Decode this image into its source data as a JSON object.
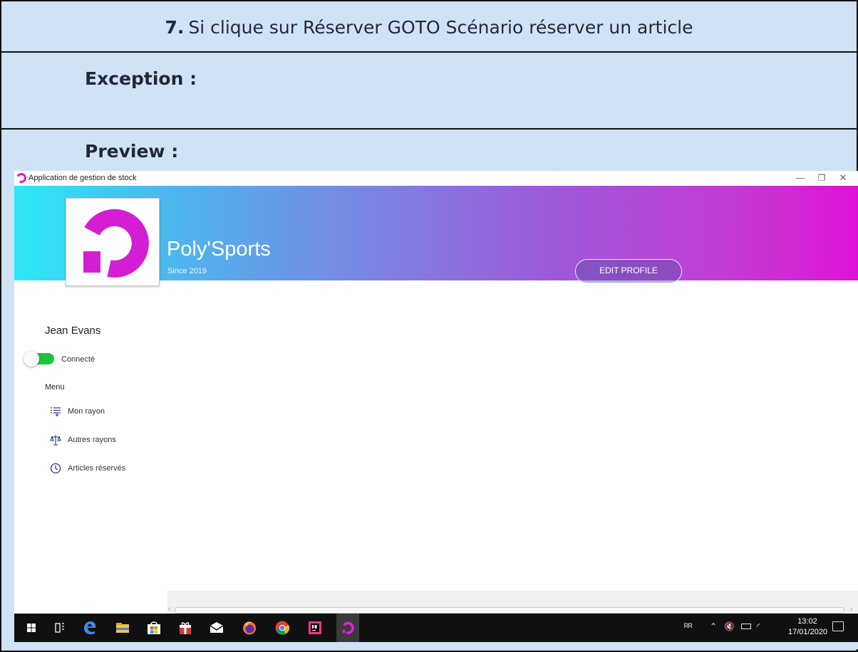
{
  "document": {
    "step_number": "7.",
    "step_text": "Si clique sur Réserver GOTO Scénario réserver un article",
    "exception_label": "Exception :",
    "preview_label": "Preview :"
  },
  "window": {
    "title": "Application de gestion de stock",
    "controls": {
      "minimize": "—",
      "maximize": "❐",
      "close": "✕"
    }
  },
  "header": {
    "brand": "Poly'Sports",
    "since": "Since 2019",
    "edit_profile": "EDIT PROFILE",
    "gradient_colors": [
      "#2de8f5",
      "#7a84e0",
      "#dd12d5"
    ]
  },
  "sidebar": {
    "user_name": "Jean Evans",
    "status_toggle": {
      "label": "Connecté",
      "on": true,
      "color": "#1fc33c"
    },
    "menu_title": "Menu",
    "items": [
      {
        "label": "Mon rayon",
        "icon": "list-icon"
      },
      {
        "label": "Autres rayons",
        "icon": "scale-icon"
      },
      {
        "label": "Articles réservés",
        "icon": "clock-icon"
      }
    ]
  },
  "taskbar": {
    "apps": [
      "windows-start",
      "task-view",
      "edge",
      "file-explorer",
      "store",
      "gift-app",
      "mail",
      "firefox",
      "chrome",
      "intellij",
      "polysports-app"
    ],
    "time": "13:02",
    "date": "17/01/2020"
  },
  "colors": {
    "accent": "#d41ed4",
    "doc_background": "#d0e2f5"
  }
}
